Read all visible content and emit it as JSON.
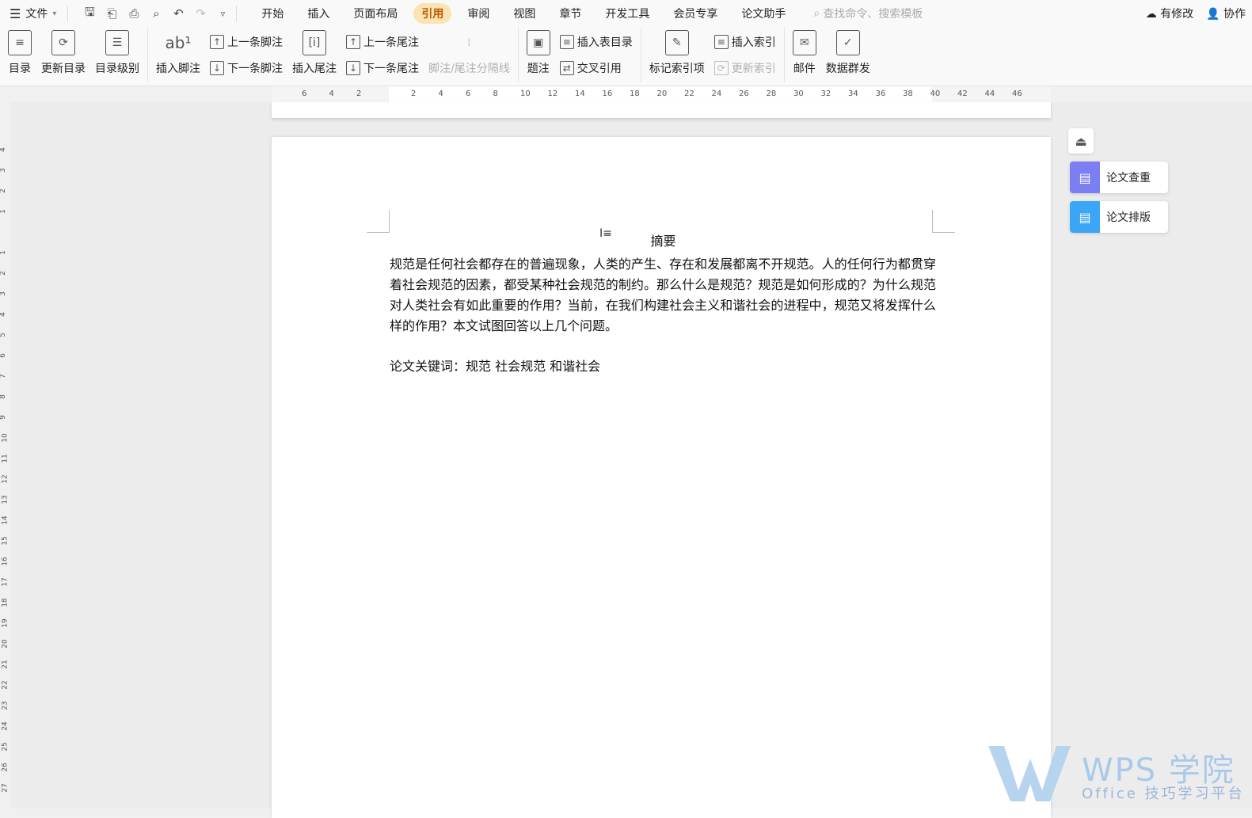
{
  "menubar": {
    "file_label": "文件",
    "tabs": [
      {
        "label": "开始",
        "active": false
      },
      {
        "label": "插入",
        "active": false
      },
      {
        "label": "页面布局",
        "active": false
      },
      {
        "label": "引用",
        "active": true
      },
      {
        "label": "审阅",
        "active": false
      },
      {
        "label": "视图",
        "active": false
      },
      {
        "label": "章节",
        "active": false
      },
      {
        "label": "开发工具",
        "active": false
      },
      {
        "label": "会员专享",
        "active": false
      },
      {
        "label": "论文助手",
        "active": false
      }
    ],
    "search_placeholder": "查找命令、搜索模板",
    "modified_label": "有修改",
    "collab_label": "协作",
    "accent_color": "#fbe4b3"
  },
  "ribbon": {
    "toc": "目录",
    "update_toc": "更新目录",
    "toc_level": "目录级别",
    "insert_footnote": "插入脚注",
    "prev_footnote": "上一条脚注",
    "next_footnote": "下一条脚注",
    "insert_endnote": "插入尾注",
    "prev_endnote": "上一条尾注",
    "next_endnote": "下一条尾注",
    "separator_line": "脚注/尾注分隔线",
    "caption": "题注",
    "insert_table_of_figures": "插入表目录",
    "cross_reference": "交叉引用",
    "mark_index_entry": "标记索引项",
    "insert_index": "插入索引",
    "update_index": "更新索引",
    "mail": "邮件",
    "data_mass_send": "数据群发"
  },
  "ruler": {
    "ticks": [
      "6",
      "4",
      "2",
      "",
      "2",
      "4",
      "6",
      "8",
      "10",
      "12",
      "14",
      "16",
      "18",
      "20",
      "22",
      "24",
      "26",
      "28",
      "30",
      "32",
      "34",
      "36",
      "38",
      "40",
      "42",
      "44",
      "46"
    ]
  },
  "vruler": {
    "ticks": [
      "4",
      "3",
      "2",
      "1",
      "",
      "1",
      "2",
      "3",
      "4",
      "5",
      "6",
      "7",
      "8",
      "9",
      "10",
      "11",
      "12",
      "13",
      "14",
      "15",
      "16",
      "17",
      "18",
      "19",
      "20",
      "21",
      "22",
      "23",
      "24",
      "25",
      "26",
      "27"
    ]
  },
  "document": {
    "title": "摘要",
    "paragraph": "规范是任何社会都存在的普遍现象，人类的产生、存在和发展都离不开规范。人的任何行为都贯穿着社会规范的因素，都受某种社会规范的制约。那么什么是规范？规范是如何形成的？为什么规范对人类社会有如此重要的作用？当前，在我们构建社会主义和谐社会的进程中，规范又将发挥什么样的作用？本文试图回答以上几个问题。",
    "keywords": "论文关键词：规范  社会规范   和谐社会"
  },
  "sidepanel": {
    "check_label": "论文查重",
    "format_label": "论文排版",
    "check_color": "#7b7ff2",
    "format_color": "#3aa6f5"
  },
  "watermark": {
    "brand": "WPS 学院",
    "sub": "Office 技巧学习平台"
  }
}
